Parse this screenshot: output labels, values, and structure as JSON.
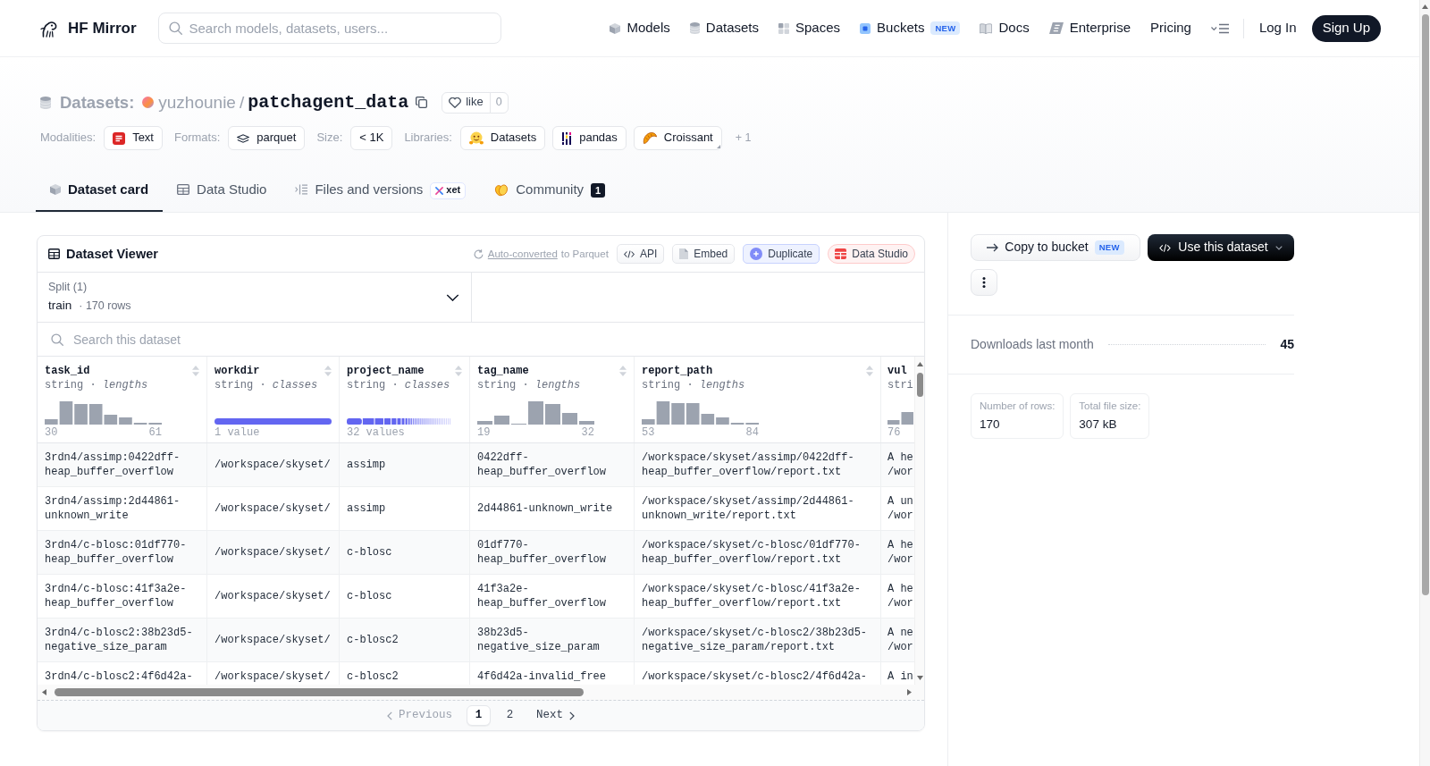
{
  "navbar": {
    "brand": "HF Mirror",
    "search": {
      "placeholder": "Search models, datasets, users..."
    },
    "items": [
      {
        "label": "Models"
      },
      {
        "label": "Datasets"
      },
      {
        "label": "Spaces"
      },
      {
        "label": "Buckets",
        "badge": "NEW"
      },
      {
        "label": "Docs"
      },
      {
        "label": "Enterprise"
      },
      {
        "label": "Pricing"
      }
    ],
    "login": "Log In",
    "signup": "Sign Up"
  },
  "header": {
    "repo_type": "Datasets:",
    "owner": "yuzhounie",
    "separator": "/",
    "name": "patchagent_data",
    "like": {
      "label": "like",
      "count": "0"
    },
    "tag_groups": [
      {
        "label": "Modalities:",
        "tags": [
          "Text"
        ]
      },
      {
        "label": "Formats:",
        "tags": [
          "parquet"
        ]
      },
      {
        "label": "Size:",
        "tags": [
          "< 1K"
        ]
      },
      {
        "label": "Libraries:",
        "tags": [
          "Datasets",
          "pandas",
          "Croissant"
        ]
      }
    ],
    "more": "+ 1"
  },
  "tabs": [
    {
      "label": "Dataset card",
      "selected": true
    },
    {
      "label": "Data Studio",
      "selected": false
    },
    {
      "label": "Files and versions",
      "selected": false,
      "badge": "xet"
    },
    {
      "label": "Community",
      "selected": false,
      "count": "1"
    }
  ],
  "viewer": {
    "title": "Dataset Viewer",
    "note": {
      "link": "Auto-converted",
      "text": "to Parquet"
    },
    "buttons": [
      {
        "label": "API",
        "kind": "plain"
      },
      {
        "label": "Embed",
        "kind": "plain"
      },
      {
        "label": "Duplicate",
        "kind": "accent"
      },
      {
        "label": "Data Studio",
        "kind": "danger"
      }
    ],
    "split": {
      "label": "Split (1)",
      "value": "train",
      "detail": "· 170 rows"
    },
    "search": {
      "placeholder": "Search this dataset"
    },
    "columns": [
      {
        "name": "task_id",
        "type": "string · *lengths*",
        "kind": "histogram",
        "min": "30",
        "max": "61",
        "sortable": true
      },
      {
        "name": "workdir",
        "type": "string · *classes*",
        "kind": "classes",
        "summary": "1 value",
        "sortable": true
      },
      {
        "name": "project_name",
        "type": "string · *classes*",
        "kind": "classes",
        "summary": "32 values",
        "sortable": true
      },
      {
        "name": "tag_name",
        "type": "string · *lengths*",
        "kind": "histogram",
        "min": "19",
        "max": "32",
        "sortable": true
      },
      {
        "name": "report_path",
        "type": "string · *lengths*",
        "kind": "histogram",
        "min": "53",
        "max": "84",
        "sortable": true
      },
      {
        "name": "vul",
        "type": "stri",
        "kind": "histogram",
        "min": "76",
        "sortable": false
      }
    ],
    "rows": [
      [
        "3rdn4/assimp:0422dff-heap_buffer_overflow",
        "/workspace/skyset/",
        "assimp",
        "0422dff-heap_buffer_overflow",
        "/workspace/skyset/assimp/0422dff-heap_buffer_overflow/report.txt",
        "A he\n/wor"
      ],
      [
        "3rdn4/assimp:2d44861-unknown_write",
        "/workspace/skyset/",
        "assimp",
        "2d44861-unknown_write",
        "/workspace/skyset/assimp/2d44861-unknown_write/report.txt",
        "A un\n/wor"
      ],
      [
        "3rdn4/c-blosc:01df770-heap_buffer_overflow",
        "/workspace/skyset/",
        "c-blosc",
        "01df770-heap_buffer_overflow",
        "/workspace/skyset/c-blosc/01df770-heap_buffer_overflow/report.txt",
        "A he\n/wor"
      ],
      [
        "3rdn4/c-blosc:41f3a2e-heap_buffer_overflow",
        "/workspace/skyset/",
        "c-blosc",
        "41f3a2e-heap_buffer_overflow",
        "/workspace/skyset/c-blosc/41f3a2e-heap_buffer_overflow/report.txt",
        "A he\n/wor"
      ],
      [
        "3rdn4/c-blosc2:38b23d5-negative_size_param",
        "/workspace/skyset/",
        "c-blosc2",
        "38b23d5-negative_size_param",
        "/workspace/skyset/c-blosc2/38b23d5-negative_size_param/report.txt",
        "A ne\n/wor"
      ],
      [
        "3rdn4/c-blosc2:4f6d42a-",
        "/workspace/skyset/",
        "c-blosc2",
        "4f6d42a-invalid_free",
        "/workspace/skyset/c-blosc2/4f6d42a-",
        "A in"
      ]
    ],
    "pagination": {
      "previous": {
        "label": "Previous",
        "disabled": true
      },
      "pages": [
        {
          "label": "1",
          "selected": true
        },
        {
          "label": "2",
          "selected": false
        }
      ],
      "next": {
        "label": "Next",
        "disabled": false
      }
    }
  },
  "sidebar": {
    "copy_button": {
      "label": "Copy to bucket",
      "badge": "NEW"
    },
    "use_button": {
      "label": "Use this dataset"
    },
    "downloads": {
      "label": "Downloads last month",
      "value": "45"
    },
    "stats": [
      {
        "label": "Number of rows:",
        "value": "170"
      },
      {
        "label": "Total file size:",
        "value": "307 kB"
      }
    ]
  }
}
